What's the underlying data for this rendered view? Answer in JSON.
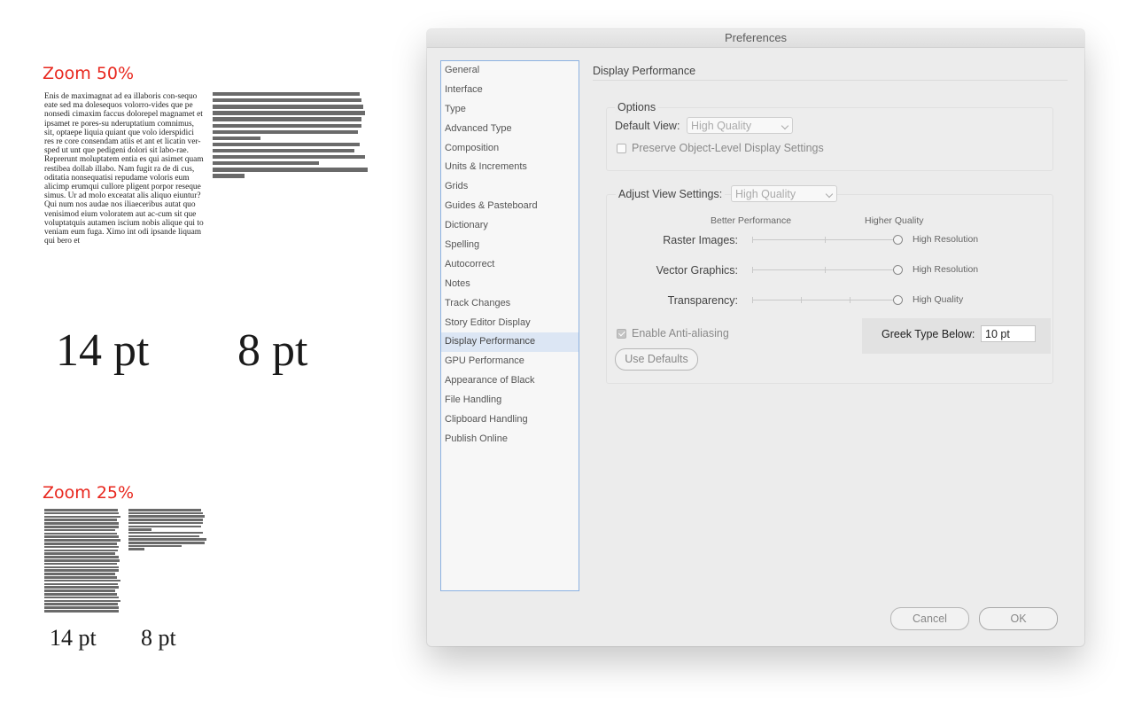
{
  "demo": {
    "zoom50_label": "Zoom 50%",
    "zoom25_label": "Zoom 25%",
    "sample_text": "Enis de maximagnat ad ea illaboris con-sequo eate sed ma dolesequos volorro-vides que pe nonsedi cimaxim faccus dolorepel magnamet et ipsamet re pores-su nderuptatium comnimus, sit, optaepe liquia quiant que volo iderspidici res re core consendam atiis et ant et licatin ver-sped ut unt que pedigeni dolori sit labo-rae. Reprerunt moluptatem entia es qui asimet quam restibea dollab illabo. Nam fugit ra de di cus, oditatia nonsequatisi repudame voloris eum alicimp erumqui cullore pligent porpor reseque simus. Ur ad molo exceatat alis aliquo eiuntur? Qui num nos audae nos iliaeceribus autat quo venisimod eium voloratem aut ac-cum sit que voluptatquis autamen iscium nobis alique qui to veniam eum fuga. Ximo int odi ipsande liquam qui bero et",
    "pt14_label": "14 pt",
    "pt8_label": "8 pt",
    "greek_bar_color": "#6a6a6a"
  },
  "dialog": {
    "title": "Preferences",
    "sidebar_items": [
      "General",
      "Interface",
      "Type",
      "Advanced Type",
      "Composition",
      "Units & Increments",
      "Grids",
      "Guides & Pasteboard",
      "Dictionary",
      "Spelling",
      "Autocorrect",
      "Notes",
      "Track Changes",
      "Story Editor Display",
      "Display Performance",
      "GPU Performance",
      "Appearance of Black",
      "File Handling",
      "Clipboard Handling",
      "Publish Online"
    ],
    "selected_item": "Display Performance",
    "section_title": "Display Performance",
    "options": {
      "legend": "Options",
      "default_view_label": "Default View:",
      "default_view_value": "High Quality",
      "preserve_label": "Preserve Object-Level Display Settings",
      "preserve_checked": false
    },
    "adjust": {
      "label": "Adjust View Settings:",
      "value": "High Quality",
      "better_performance": "Better Performance",
      "higher_quality": "Higher Quality",
      "sliders": [
        {
          "label": "Raster Images:",
          "value_label": "High Resolution",
          "level": 1.0
        },
        {
          "label": "Vector Graphics:",
          "value_label": "High Resolution",
          "level": 1.0
        },
        {
          "label": "Transparency:",
          "value_label": "High Quality",
          "level": 1.0
        }
      ],
      "anti_aliasing_label": "Enable Anti-aliasing",
      "anti_aliasing_checked": true,
      "use_defaults": "Use Defaults",
      "greek_label": "Greek Type Below:",
      "greek_value": "10 pt"
    },
    "buttons": {
      "cancel": "Cancel",
      "ok": "OK"
    },
    "colors": {
      "selection": "#dce6f4",
      "sidebar_border": "#8cb2e2",
      "zoom_label": "#e8271e"
    }
  }
}
